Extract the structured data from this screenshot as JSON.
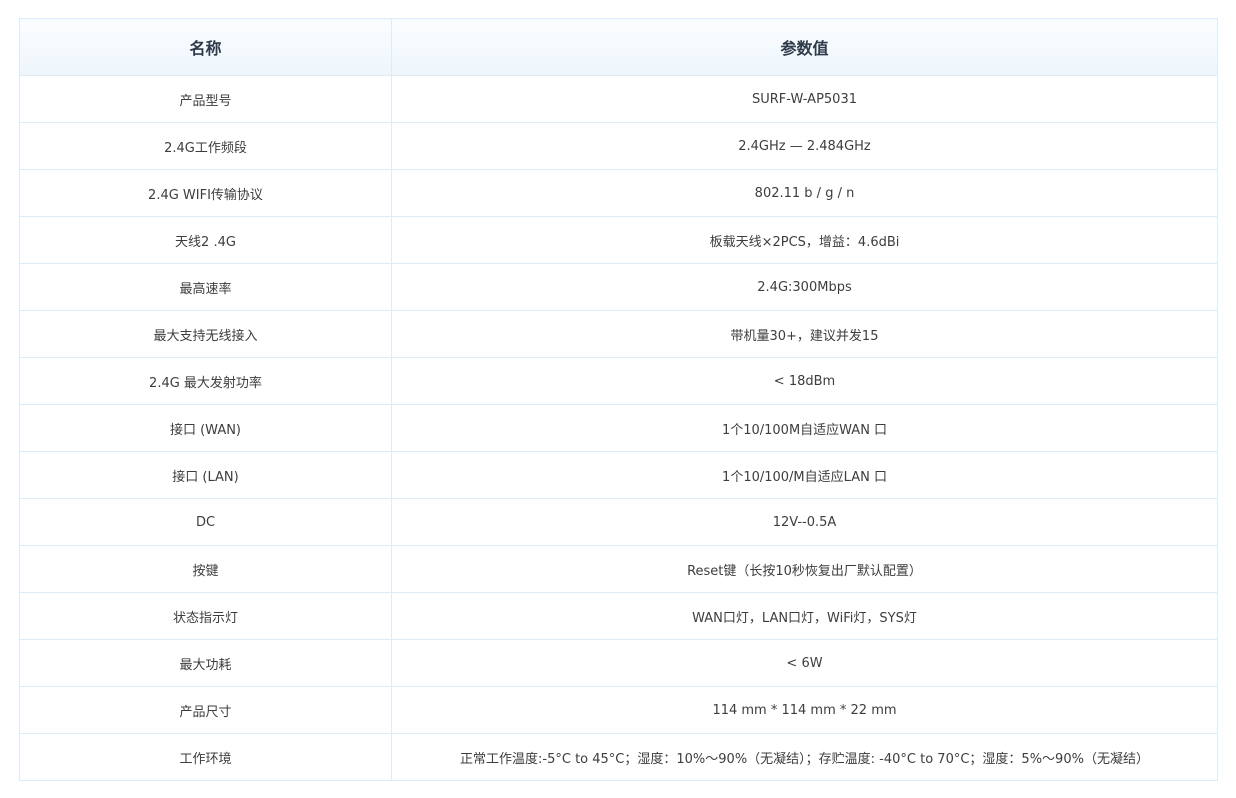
{
  "table": {
    "headers": [
      "名称",
      "参数值"
    ],
    "rows": [
      {
        "name": "产品型号",
        "value": "SURF-W-AP5031"
      },
      {
        "name": "2.4G工作频段",
        "value": "2.4GHz — 2.484GHz"
      },
      {
        "name": "2.4G WIFI传输协议",
        "value": "802.11 b / g / n"
      },
      {
        "name": "天线2 .4G",
        "value": "板载天线×2PCS，增益：4.6dBi"
      },
      {
        "name": "最高速率",
        "value": "2.4G:300Mbps"
      },
      {
        "name": "最大支持无线接入",
        "value": "带机量30+，建议并发15"
      },
      {
        "name": "2.4G 最大发射功率",
        "value": "< 18dBm"
      },
      {
        "name": "接口 (WAN)",
        "value": "1个10/100M自适应WAN 口"
      },
      {
        "name": "接口 (LAN)",
        "value": "1个10/100/M自适应LAN 口"
      },
      {
        "name": "DC",
        "value": "12V--0.5A"
      },
      {
        "name": "按键",
        "value": "Reset键（长按10秒恢复出厂默认配置）"
      },
      {
        "name": "状态指示灯",
        "value": "WAN口灯，LAN口灯，WiFi灯，SYS灯"
      },
      {
        "name": "最大功耗",
        "value": "< 6W"
      },
      {
        "name": "产品尺寸",
        "value": "114 mm * 114 mm * 22 mm"
      },
      {
        "name": "工作环境",
        "value": "正常工作温度:-5°C to   45°C；湿度：10%～90%（无凝结）；存贮温度: -40°C to   70°C；湿度：5%～90%（无凝结）"
      }
    ]
  }
}
